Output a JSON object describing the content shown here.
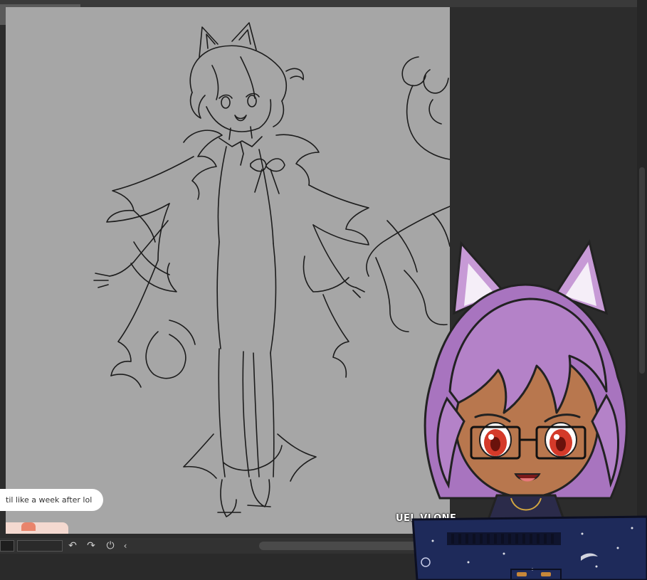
{
  "window": {
    "minimize_glyph": "—",
    "close_glyph": "✕"
  },
  "chat": {
    "message": "til like a week after lol"
  },
  "watermark": {
    "text": "UEL VLONE"
  },
  "toolbar": {
    "undo_icon": "undo-icon",
    "redo_icon": "redo-icon",
    "rotate_reset_icon": "rotate-reset-icon",
    "collapse_icon": "chevron-left-icon"
  },
  "colors": {
    "canvas_bg": "#a6a6a6",
    "app_bg": "#2c2c2c",
    "sketch_line": "#1c1c1c",
    "avatar_hair": "#b482c8",
    "avatar_eyes": "#d43a2a",
    "desk_navy": "#1e2a5a"
  }
}
